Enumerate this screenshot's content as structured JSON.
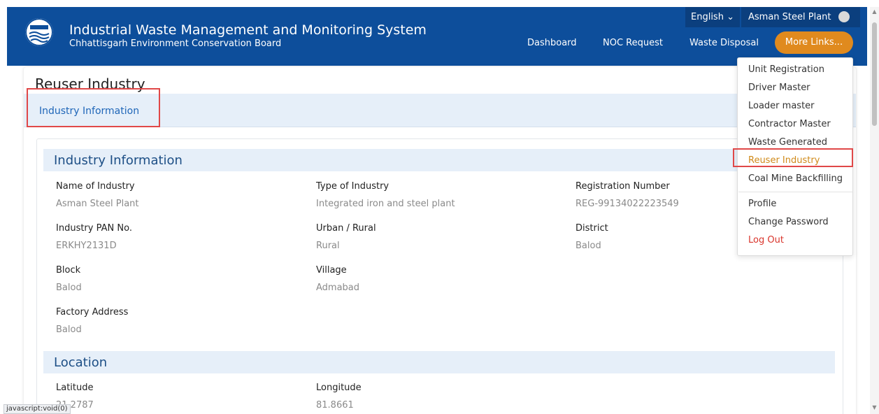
{
  "header": {
    "title": "Industrial Waste Management and Monitoring System",
    "subtitle": "Chhattisgarh Environment Conservation Board",
    "language": "English",
    "user": "Asman Steel Plant",
    "nav": [
      "Dashboard",
      "NOC Request",
      "Waste Disposal"
    ],
    "more_links": "More Links..."
  },
  "page": {
    "title": "Reuser Industry",
    "tab": "Industry Information"
  },
  "industry_info": {
    "heading": "Industry Information",
    "fields": [
      {
        "label": "Name of Industry",
        "value": "Asman Steel Plant"
      },
      {
        "label": "Type of Industry",
        "value": "Integrated iron and steel plant"
      },
      {
        "label": "Registration Number",
        "value": "REG-99134022223549"
      },
      {
        "label": "Industry PAN No.",
        "value": "ERKHY2131D"
      },
      {
        "label": "Urban / Rural",
        "value": "Rural"
      },
      {
        "label": "District",
        "value": "Balod"
      },
      {
        "label": "Block",
        "value": "Balod"
      },
      {
        "label": "Village",
        "value": "Admabad"
      },
      {
        "label": "Factory Address",
        "value": "Balod"
      }
    ]
  },
  "location": {
    "heading": "Location",
    "fields": [
      {
        "label": "Latitude",
        "value": "21.2787"
      },
      {
        "label": "Longitude",
        "value": "81.8661"
      }
    ]
  },
  "dropdown": {
    "items": [
      "Unit Registration",
      "Driver Master",
      "Loader master",
      "Contractor Master",
      "Waste Generated",
      "Reuser Industry",
      "Coal Mine Backfilling"
    ],
    "account_items": [
      "Profile",
      "Change Password",
      "Log Out"
    ]
  },
  "status_bar": "javascript:void(0)",
  "colors": {
    "header_bg": "#0d4e9b",
    "accent_orange": "#e08a1e",
    "active_link": "#d08a1a",
    "logout": "#d9342b",
    "highlight": "#e04848"
  }
}
